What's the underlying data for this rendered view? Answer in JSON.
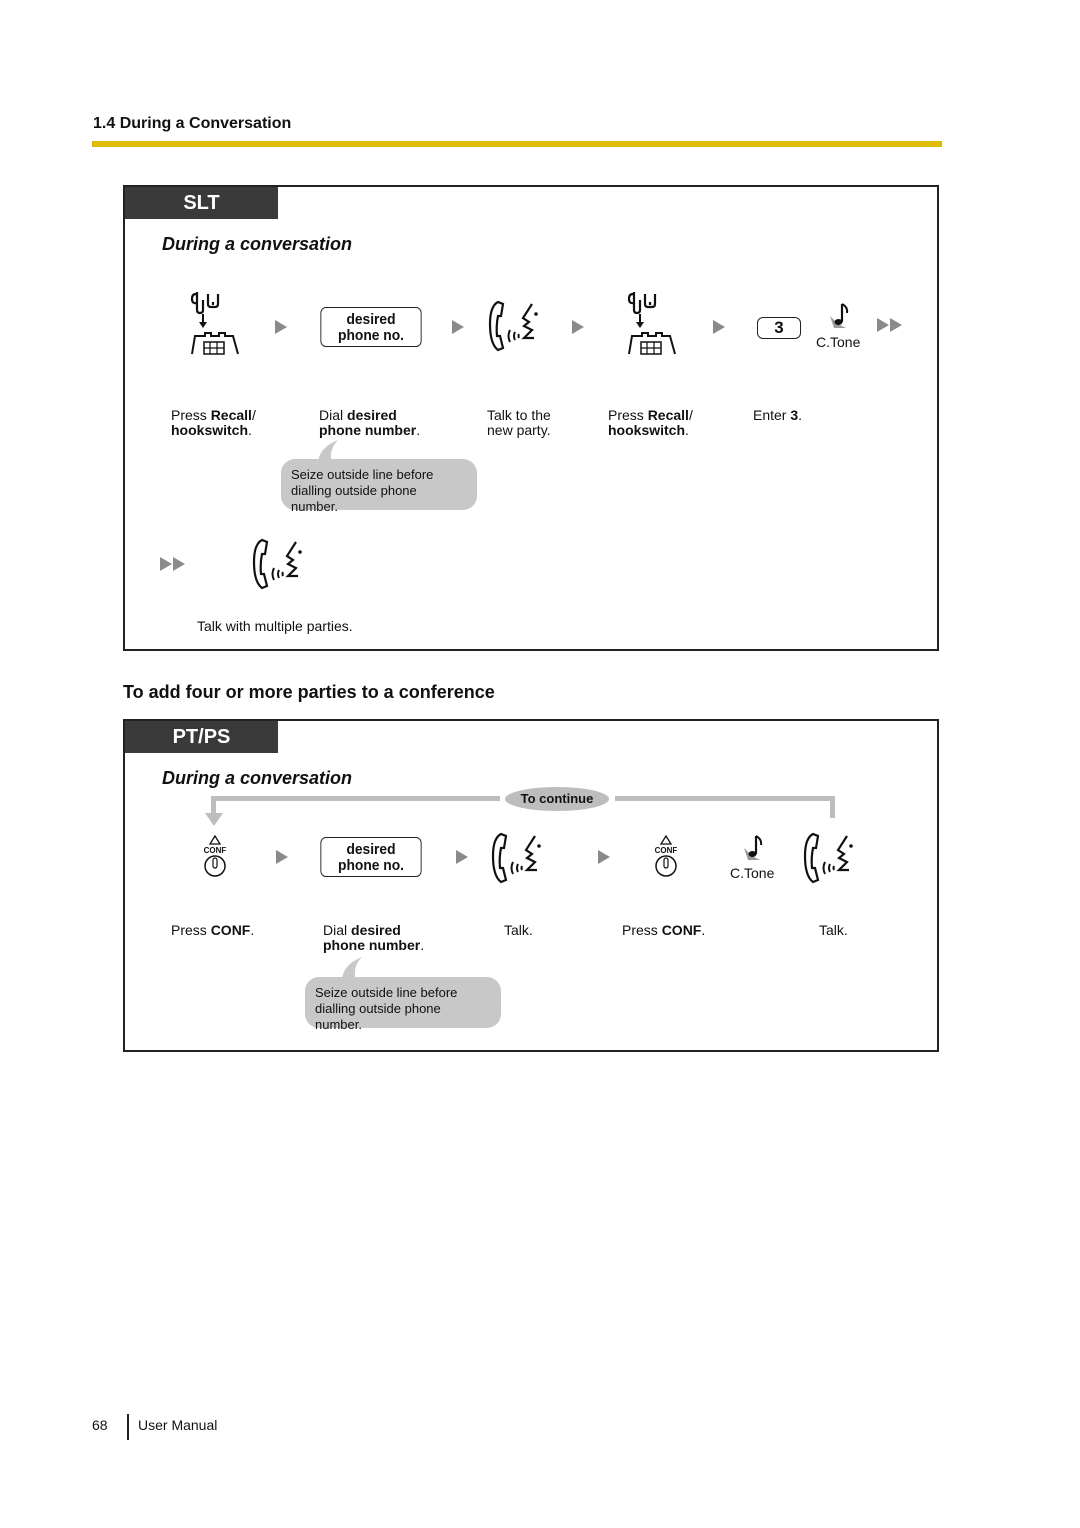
{
  "header": {
    "section_title": "1.4 During a Conversation"
  },
  "slt_panel": {
    "tab_label": "SLT",
    "title": "During a conversation",
    "desired_key": {
      "line1": "desired",
      "line2": "phone no."
    },
    "key_3": "3",
    "c_tone": "C.Tone",
    "steps": [
      {
        "pre": "Press ",
        "bold": "Recall",
        "post": "/",
        "line2_bold": "hookswitch",
        "line2_post": "."
      },
      {
        "pre": "Dial ",
        "bold": "desired",
        "post": "",
        "line2_bold": "phone number",
        "line2_post": "."
      },
      {
        "line1": "Talk to the",
        "line2": "new party."
      },
      {
        "pre": "Press ",
        "bold": "Recall",
        "post": "/",
        "line2_bold": "hookswitch",
        "line2_post": "."
      },
      {
        "pre": "Enter ",
        "bold": "3",
        "post": "."
      }
    ],
    "note": {
      "line1": "Seize outside line before",
      "line2": "dialling outside phone number."
    },
    "final_caption": "Talk with multiple parties."
  },
  "conference_section": {
    "title": "To add four or more parties to a conference"
  },
  "ptps_panel": {
    "tab_label": "PT/PS",
    "title": "During a conversation",
    "loop_label": "To continue",
    "conf_label": "CONF",
    "desired_key": {
      "line1": "desired",
      "line2": "phone no."
    },
    "c_tone": "C.Tone",
    "steps": [
      {
        "pre": "Press ",
        "bold": "CONF",
        "post": "."
      },
      {
        "pre": "Dial ",
        "bold": "desired",
        "post": "",
        "line2_bold": "phone number",
        "line2_post": "."
      },
      {
        "line1": "Talk."
      },
      {
        "pre": "Press ",
        "bold": "CONF",
        "post": "."
      },
      {
        "line1": "Talk."
      }
    ],
    "note": {
      "line1": "Seize outside line before",
      "line2": "dialling outside phone number."
    }
  },
  "footer": {
    "page_number": "68",
    "doc_name": "User Manual"
  },
  "colors": {
    "accent_rule": "#e0bc00",
    "tab_bg": "#3a3a3a",
    "arrow": "#8a8a8a",
    "bubble": "#c8c8c8"
  }
}
